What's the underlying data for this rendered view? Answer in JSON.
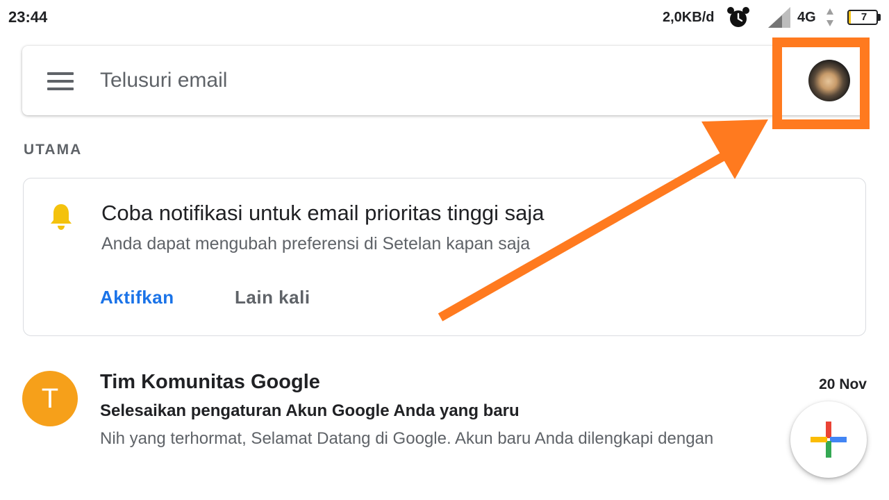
{
  "status_bar": {
    "time": "23:44",
    "data_speed": "2,0KB/d",
    "network": "4G",
    "battery_level": "7",
    "battery_fraction": 0.07
  },
  "search": {
    "placeholder": "Telusuri email",
    "menu_icon": "menu-icon",
    "account_icon": "account-avatar"
  },
  "annotation": {
    "color": "#ff7a1f"
  },
  "section": {
    "label": "UTAMA"
  },
  "notification_card": {
    "icon": "bell-icon",
    "icon_color": "#f4c20d",
    "title": "Coba notifikasi untuk email prioritas tinggi saja",
    "subtitle": "Anda dapat mengubah preferensi di Setelan kapan saja",
    "enable_label": "Aktifkan",
    "later_label": "Lain kali",
    "accent": "#1a73e8"
  },
  "inbox": {
    "emails": [
      {
        "avatar_letter": "T",
        "avatar_color": "#f6a01a",
        "sender": "Tim Komunitas Google",
        "date": "20 Nov",
        "subject": "Selesaikan pengaturan Akun Google Anda yang baru",
        "snippet": "Nih yang terhormat, Selamat Datang di Google. Akun baru Anda dilengkapi dengan"
      }
    ]
  },
  "compose": {
    "icon": "plus-icon"
  }
}
